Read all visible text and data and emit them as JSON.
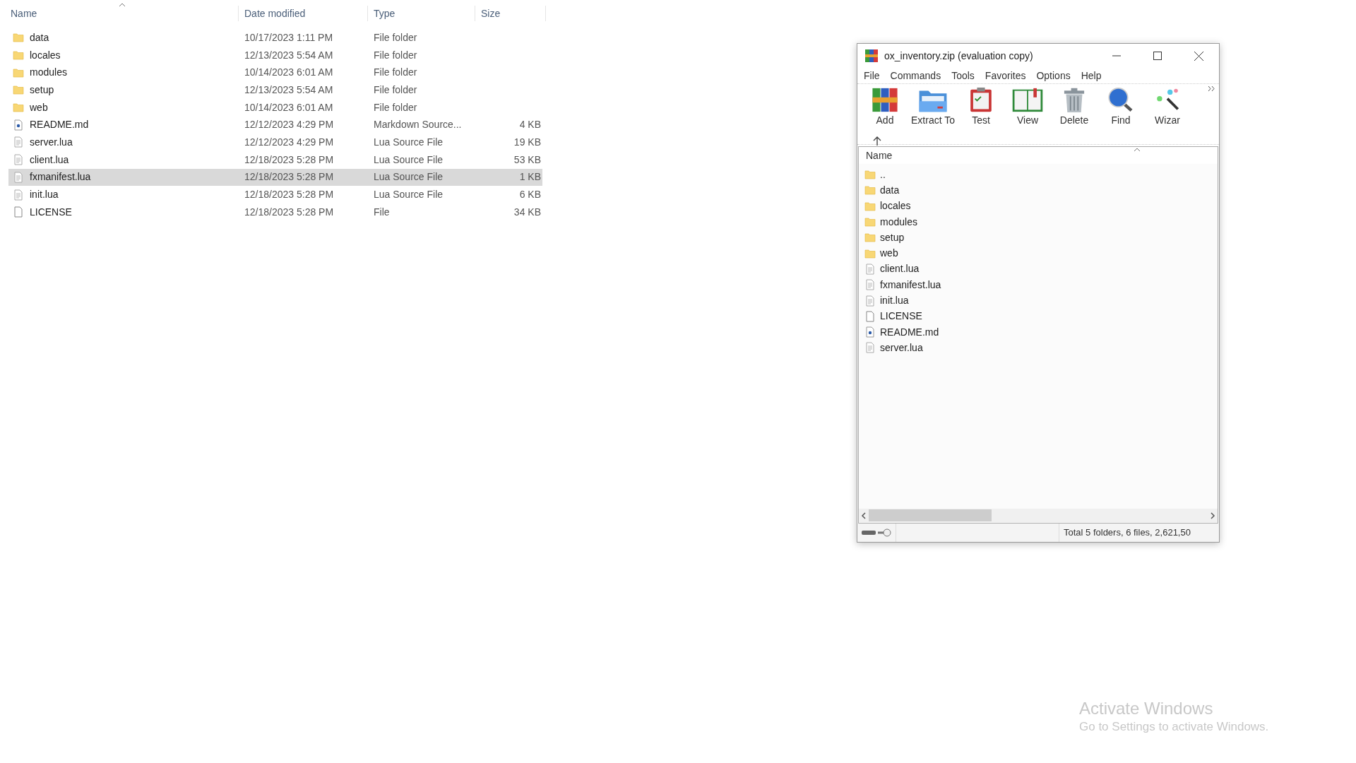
{
  "explorer": {
    "columns": [
      "Name",
      "Date modified",
      "Type",
      "Size"
    ],
    "rows": [
      {
        "name": "data",
        "date": "10/17/2023 1:11 PM",
        "type": "File folder",
        "kind": "folder",
        "selected": false
      },
      {
        "name": "locales",
        "date": "12/13/2023 5:54 AM",
        "type": "File folder",
        "kind": "folder",
        "selected": false
      },
      {
        "name": "modules",
        "date": "10/14/2023 6:01 AM",
        "type": "File folder",
        "kind": "folder",
        "selected": false
      },
      {
        "name": "setup",
        "date": "12/13/2023 5:54 AM",
        "type": "File folder",
        "kind": "folder",
        "selected": false
      },
      {
        "name": "web",
        "date": "10/14/2023 6:01 AM",
        "type": "File folder",
        "kind": "folder",
        "selected": false
      },
      {
        "name": "README.md",
        "date": "12/12/2023 4:29 PM",
        "type": "Markdown Source...",
        "size": "4 KB",
        "kind": "markdown",
        "selected": false
      },
      {
        "name": "server.lua",
        "date": "12/12/2023 4:29 PM",
        "type": "Lua Source File",
        "size": "19 KB",
        "kind": "text",
        "selected": false
      },
      {
        "name": "client.lua",
        "date": "12/18/2023 5:28 PM",
        "type": "Lua Source File",
        "size": "53 KB",
        "kind": "text",
        "selected": false
      },
      {
        "name": "fxmanifest.lua",
        "date": "12/18/2023 5:28 PM",
        "type": "Lua Source File",
        "size": "1 KB",
        "kind": "text",
        "selected": true
      },
      {
        "name": "init.lua",
        "date": "12/18/2023 5:28 PM",
        "type": "Lua Source File",
        "size": "6 KB",
        "kind": "text",
        "selected": false
      },
      {
        "name": "LICENSE",
        "date": "12/18/2023 5:28 PM",
        "type": "File",
        "size": "34 KB",
        "kind": "blank",
        "selected": false
      }
    ]
  },
  "archive_window": {
    "title": "ox_inventory.zip (evaluation copy)",
    "menu": [
      "File",
      "Commands",
      "Tools",
      "Favorites",
      "Options",
      "Help"
    ],
    "toolbar": [
      {
        "label": "Add",
        "kind": "add"
      },
      {
        "label": "Extract To",
        "kind": "extract"
      },
      {
        "label": "Test",
        "kind": "test"
      },
      {
        "label": "View",
        "kind": "view"
      },
      {
        "label": "Delete",
        "kind": "delete"
      },
      {
        "label": "Find",
        "kind": "find"
      },
      {
        "label": "Wizar",
        "kind": "wizard"
      }
    ],
    "column": "Name",
    "items": [
      {
        "name": "..",
        "kind": "folder"
      },
      {
        "name": "data",
        "kind": "folder"
      },
      {
        "name": "locales",
        "kind": "folder"
      },
      {
        "name": "modules",
        "kind": "folder"
      },
      {
        "name": "setup",
        "kind": "folder"
      },
      {
        "name": "web",
        "kind": "folder"
      },
      {
        "name": "client.lua",
        "kind": "text"
      },
      {
        "name": "fxmanifest.lua",
        "kind": "text"
      },
      {
        "name": "init.lua",
        "kind": "text"
      },
      {
        "name": "LICENSE",
        "kind": "blank"
      },
      {
        "name": "README.md",
        "kind": "markdown"
      },
      {
        "name": "server.lua",
        "kind": "text"
      }
    ],
    "status": "Total 5 folders, 6 files, 2,621,50"
  },
  "activation": {
    "title": "Activate Windows",
    "subtitle": "Go to Settings to activate Windows."
  }
}
